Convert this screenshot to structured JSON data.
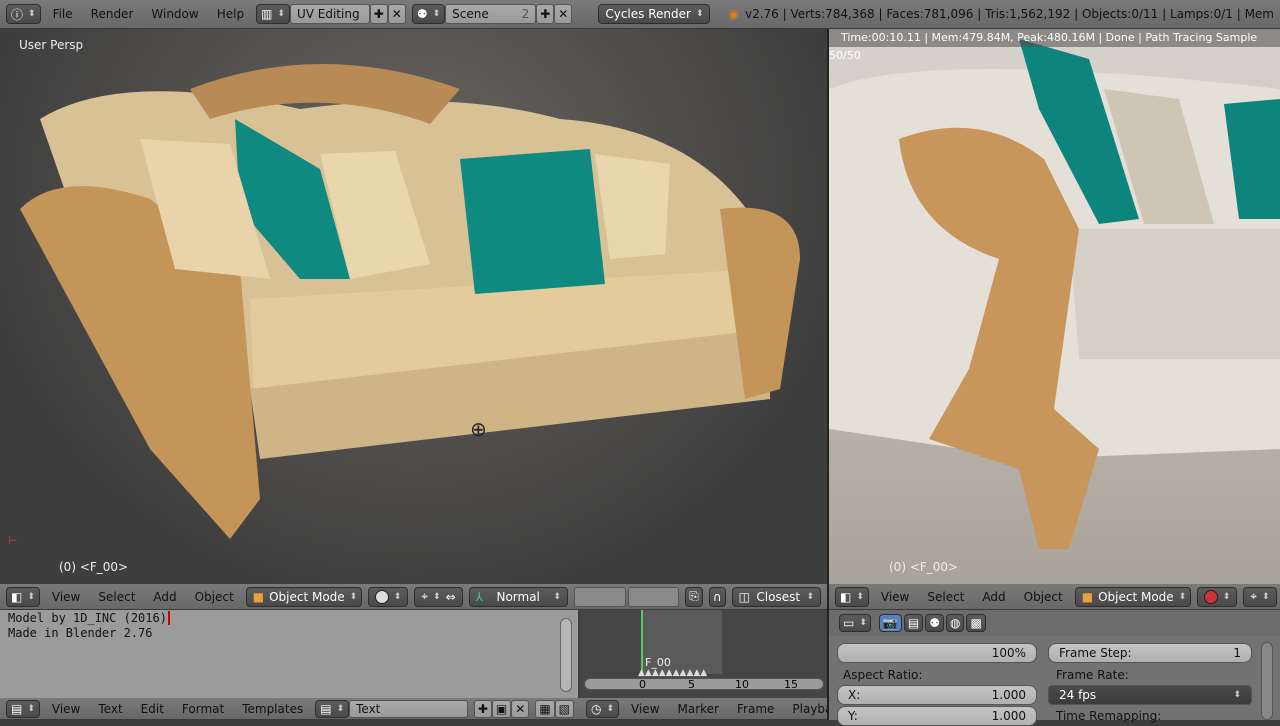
{
  "top_bar": {
    "menus": [
      "File",
      "Render",
      "Window",
      "Help"
    ],
    "screen_layout": "UV Editing",
    "scene": "Scene",
    "scene_users": "2",
    "render_engine": "Cycles Render",
    "stats": "v2.76 | Verts:784,368 | Faces:781,096 | Tris:1,562,192 | Objects:0/11 | Lamps:0/1 | Mem"
  },
  "viewport_left": {
    "view_label": "User Persp",
    "frame_label": "(0) <F_00>",
    "header": {
      "menus": [
        "View",
        "Select",
        "Add",
        "Object"
      ],
      "mode": "Object Mode",
      "orientation": "Normal",
      "snap": "Closest"
    }
  },
  "viewport_right": {
    "render_status": "Time:00:10.11 | Mem:479.84M, Peak:480.16M | Done | Path Tracing Sample 50/50",
    "frame_label": "(0) <F_00>",
    "header": {
      "menus": [
        "View",
        "Select",
        "Add",
        "Object"
      ],
      "mode": "Object Mode"
    }
  },
  "text_editor": {
    "lines": [
      "Model by 1D_INC (2016)",
      "Made in Blender 2.76"
    ],
    "header": {
      "menus": [
        "View",
        "Text",
        "Edit",
        "Format",
        "Templates"
      ],
      "datablock": "Text"
    }
  },
  "timeline": {
    "marker": "F_00",
    "ticks": [
      "0",
      "5",
      "10",
      "15"
    ],
    "header": {
      "menus": [
        "View",
        "Marker",
        "Frame",
        "Playback"
      ]
    }
  },
  "properties": {
    "resolution_pct": "100%",
    "frame_step_label": "Frame Step:",
    "frame_step": "1",
    "aspect_ratio_label": "Aspect Ratio:",
    "x_label": "X:",
    "x_value": "1.000",
    "y_label": "Y:",
    "y_value": "1.000",
    "frame_rate_label": "Frame Rate:",
    "frame_rate": "24 fps",
    "time_remapping_label": "Time Remapping:"
  },
  "colors": {
    "teal": "#0f8a80",
    "wood": "#c8955a",
    "cushion": "#e6cfa3",
    "accent": "#5680c2"
  }
}
